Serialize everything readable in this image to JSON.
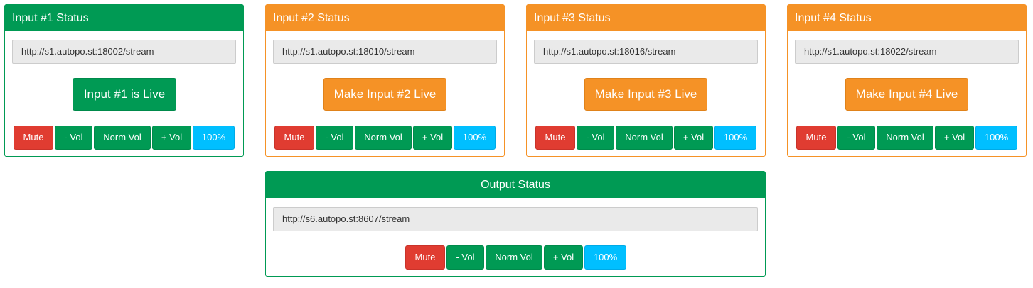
{
  "colors": {
    "live_green": "#009a54",
    "standby_orange": "#f59226",
    "mute_red": "#e03c31",
    "volume_blue": "#00bfff"
  },
  "inputs": [
    {
      "title": "Input #1 Status",
      "url": "http://s1.autopo.st:18002/stream",
      "live_button": "Input #1 is Live",
      "state": "live",
      "controls": {
        "mute": "Mute",
        "vol_down": "- Vol",
        "norm_vol": "Norm Vol",
        "vol_up": "+ Vol",
        "volume": "100%"
      }
    },
    {
      "title": "Input #2 Status",
      "url": "http://s1.autopo.st:18010/stream",
      "live_button": "Make Input #2 Live",
      "state": "standby",
      "controls": {
        "mute": "Mute",
        "vol_down": "- Vol",
        "norm_vol": "Norm Vol",
        "vol_up": "+ Vol",
        "volume": "100%"
      }
    },
    {
      "title": "Input #3 Status",
      "url": "http://s1.autopo.st:18016/stream",
      "live_button": "Make Input #3 Live",
      "state": "standby",
      "controls": {
        "mute": "Mute",
        "vol_down": "- Vol",
        "norm_vol": "Norm Vol",
        "vol_up": "+ Vol",
        "volume": "100%"
      }
    },
    {
      "title": "Input #4 Status",
      "url": "http://s1.autopo.st:18022/stream",
      "live_button": "Make Input #4 Live",
      "state": "standby",
      "controls": {
        "mute": "Mute",
        "vol_down": "- Vol",
        "norm_vol": "Norm Vol",
        "vol_up": "+ Vol",
        "volume": "100%"
      }
    }
  ],
  "output": {
    "title": "Output Status",
    "url": "http://s6.autopo.st:8607/stream",
    "controls": {
      "mute": "Mute",
      "vol_down": "- Vol",
      "norm_vol": "Norm Vol",
      "vol_up": "+ Vol",
      "volume": "100%"
    }
  }
}
